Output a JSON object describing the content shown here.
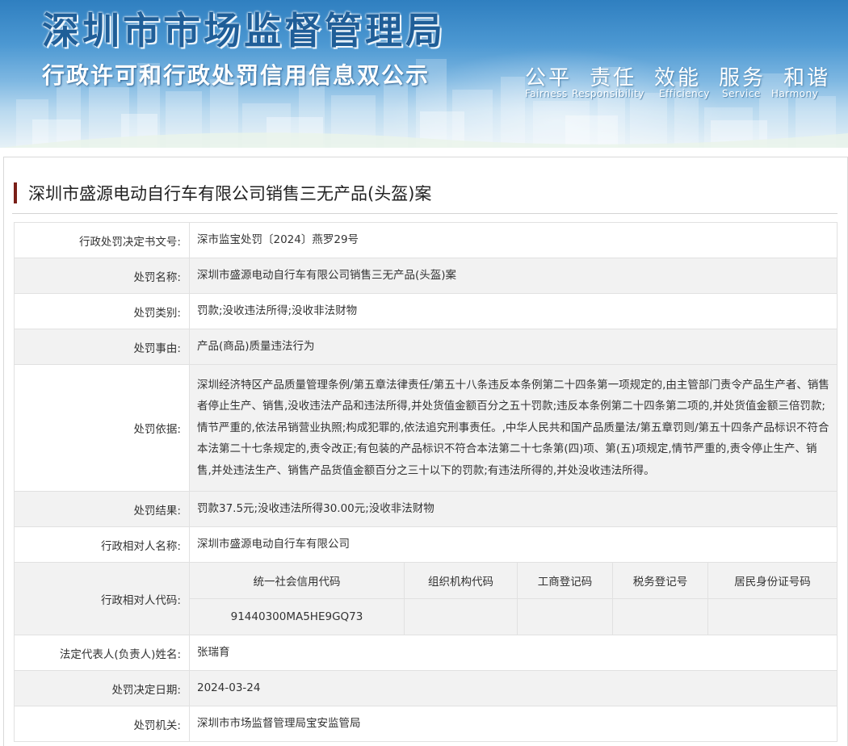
{
  "banner": {
    "title": "深圳市市场监督管理局",
    "subtitle": "行政许可和行政处罚信用信息双公示",
    "slogans": [
      "公平",
      "责任",
      "效能",
      "服务",
      "和谐"
    ],
    "slogans_en": [
      "Fairness",
      "Responsibility",
      "Efficiency",
      "Service",
      "Harmony"
    ]
  },
  "case_title": "深圳市盛源电动自行车有限公司销售三无产品(头盔)案",
  "rows": {
    "doc_no": {
      "label": "行政处罚决定书文号:",
      "value": "深市监宝处罚〔2024〕燕罗29号"
    },
    "name": {
      "label": "处罚名称:",
      "value": "深圳市盛源电动自行车有限公司销售三无产品(头盔)案"
    },
    "category": {
      "label": "处罚类别:",
      "value": "罚款;没收违法所得;没收非法财物"
    },
    "reason": {
      "label": "处罚事由:",
      "value": "产品(商品)质量违法行为"
    },
    "basis": {
      "label": "处罚依据:",
      "value": "深圳经济特区产品质量管理条例/第五章法律责任/第五十八条违反本条例第二十四条第一项规定的,由主管部门责令产品生产者、销售者停止生产、销售,没收违法产品和违法所得,并处货值金额百分之五十罚款;违反本条例第二十四条第二项的,并处货值金额三倍罚款;情节严重的,依法吊销营业执照;构成犯罪的,依法追究刑事责任。,中华人民共和国产品质量法/第五章罚则/第五十四条产品标识不符合本法第二十七条规定的,责令改正;有包装的产品标识不符合本法第二十七条第(四)项、第(五)项规定,情节严重的,责令停止生产、销售,并处违法生产、销售产品货值金额百分之三十以下的罚款;有违法所得的,并处没收违法所得。"
    },
    "result": {
      "label": "处罚结果:",
      "value": "罚款37.5元;没收违法所得30.00元;没收非法财物"
    },
    "party_name": {
      "label": "行政相对人名称:",
      "value": "深圳市盛源电动自行车有限公司"
    },
    "party_code": {
      "label": "行政相对人代码:",
      "headers": [
        "统一社会信用代码",
        "组织机构代码",
        "工商登记码",
        "税务登记号",
        "居民身份证号码"
      ],
      "values": [
        "91440300MA5HE9GQ73",
        "",
        "",
        "",
        ""
      ]
    },
    "legal_rep": {
      "label": "法定代表人(负责人)姓名:",
      "value": "张瑞育"
    },
    "decision_date": {
      "label": "处罚决定日期:",
      "value": "2024-03-24"
    },
    "authority": {
      "label": "处罚机关:",
      "value": "深圳市市场监督管理局宝安监管局"
    }
  }
}
